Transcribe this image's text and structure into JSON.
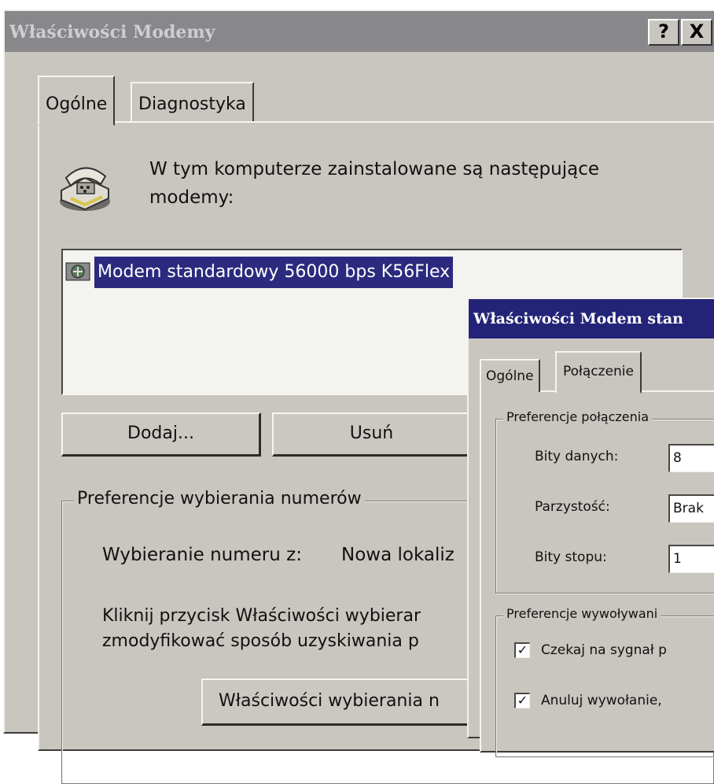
{
  "main_window": {
    "title": "Właściwości Modemy",
    "help_button": "?",
    "close_button": "X",
    "tabs": [
      {
        "label": "Ogólne",
        "active": true
      },
      {
        "label": "Diagnostyka",
        "active": false
      }
    ],
    "intro_text_line1": "W tym komputerze zainstalowane są następujące",
    "intro_text_line2": "modemy:",
    "modem_list": [
      "Modem standardowy 56000 bps K56Flex"
    ],
    "buttons": {
      "add": "Dodaj...",
      "remove": "Usuń"
    },
    "dialing_group": {
      "legend": "Preferencje wybierania numerów",
      "dial_from_label": "Wybieranie numeru z:",
      "dial_from_value": "Nowa lokaliz",
      "info_line1": "Kliknij przycisk Właściwości wybierar",
      "info_line2": "zmodyfikować sposób uzyskiwania p",
      "dialing_properties_button": "Właściwości wybierania n"
    }
  },
  "sub_window": {
    "title": "Właściwości Modem stan",
    "tabs": [
      {
        "label": "Ogólne",
        "active": false
      },
      {
        "label": "Połączenie",
        "active": true
      }
    ],
    "connection_group": {
      "legend": "Preferencje połączenia",
      "fields": [
        {
          "label": "Bity danych:",
          "value": "8"
        },
        {
          "label": "Parzystość:",
          "value": "Brak"
        },
        {
          "label": "Bity stopu:",
          "value": "1"
        }
      ]
    },
    "call_group": {
      "legend": "Preferencje wywoływani",
      "checkboxes": [
        {
          "label": "Czekaj na sygnał p",
          "checked": true
        },
        {
          "label": "Anuluj wywołanie,",
          "checked": true
        }
      ]
    }
  },
  "colors": {
    "face": "#c9c6c0",
    "inactive_title": "#88878a",
    "active_title": "#232378",
    "selection": "#2c2a7e"
  }
}
